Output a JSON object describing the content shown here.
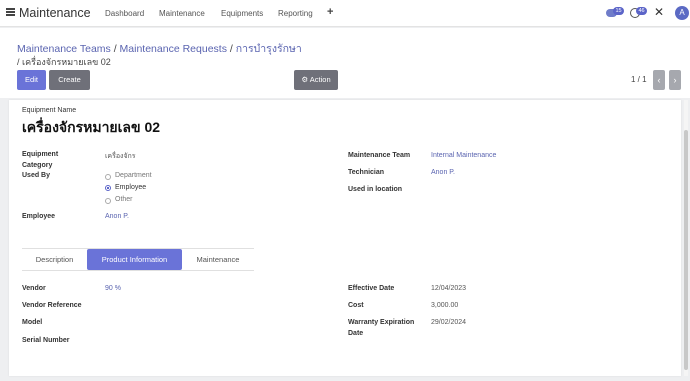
{
  "topbar": {
    "app_title": "Maintenance",
    "menu": [
      "Dashboard",
      "Maintenance",
      "Equipments",
      "Reporting"
    ],
    "plus": "+",
    "chat_badge": "15",
    "activity_badge": "46",
    "close": "✕",
    "avatar_letter": "A"
  },
  "breadcrumb": {
    "part1": "Maintenance Teams",
    "part2": "Maintenance Requests",
    "part3": "การบำรุงรักษา",
    "current": "เครื่องจักรหมายเลข 02",
    "sep": " / "
  },
  "buttons": {
    "edit": "Edit",
    "create": "Create",
    "action": "⚙ Action"
  },
  "pager": {
    "text": "1 / 1",
    "prev": "‹",
    "next": "›"
  },
  "form": {
    "equipment_name_label": "Equipment Name",
    "equipment_name": "เครื่องจักรหมายเลข 02",
    "category_label_1": "Equipment",
    "category_label_2": "Category",
    "category_value": "เครื่องจักร",
    "used_by_label": "Used By",
    "used_by_options": [
      "Department",
      "Employee",
      "Other"
    ],
    "used_by_selected": "Employee",
    "employee_label": "Employee",
    "employee_value": "Anon P.",
    "team_label": "Maintenance Team",
    "team_value": "Internal Maintenance",
    "technician_label": "Technician",
    "technician_value": "Anon P.",
    "location_label": "Used in location",
    "location_value": ""
  },
  "tabs": [
    "Description",
    "Product Information",
    "Maintenance"
  ],
  "active_tab": "Product Information",
  "product_info": {
    "vendor_label": "Vendor",
    "vendor_value": "90 %",
    "vendor_ref_label": "Vendor Reference",
    "model_label": "Model",
    "serial_label": "Serial Number",
    "effective_label": "Effective Date",
    "effective_value": "12/04/2023",
    "cost_label": "Cost",
    "cost_value": "3,000.00",
    "warranty_label_1": "Warranty Expiration",
    "warranty_label_2": "Date",
    "warranty_value": "29/02/2024"
  },
  "colors": {
    "accent": "#6a73d8",
    "secondary": "#6f7079",
    "link": "#5a64b0"
  }
}
